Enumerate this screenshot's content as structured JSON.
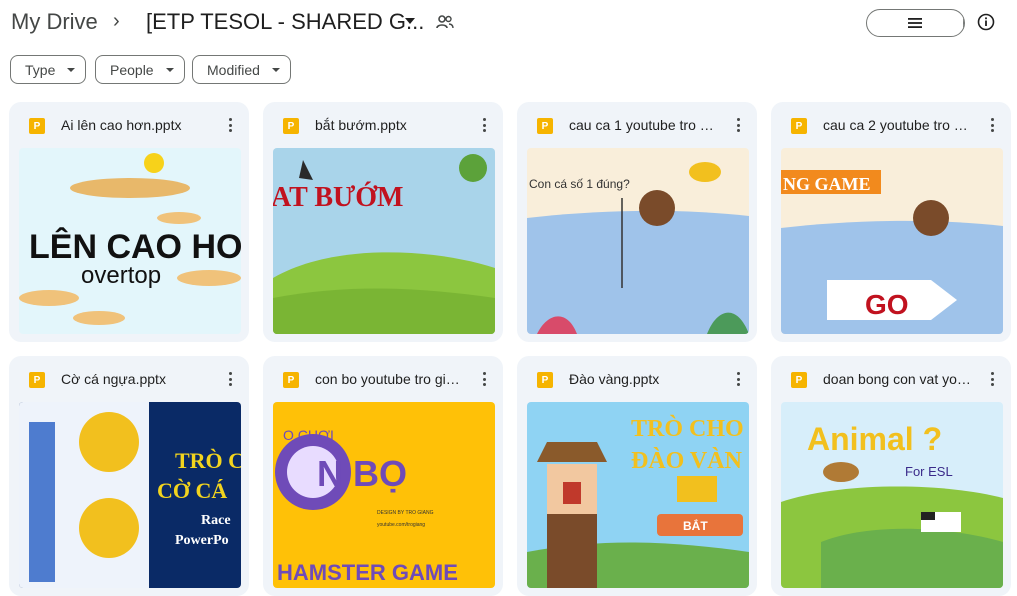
{
  "breadcrumb": {
    "root": "My Drive",
    "separator": "›",
    "current": "[ETP TESOL - SHARED G..."
  },
  "view": {
    "list_icon": "list-icon",
    "grid_icon": "grid-icon",
    "check_icon": "check-icon"
  },
  "filters": [
    {
      "label": "Type"
    },
    {
      "label": "People"
    },
    {
      "label": "Modified"
    }
  ],
  "files": [
    {
      "name": "Ai lên cao hơn.pptx",
      "badge": "P",
      "thumb_text": [
        "LÊN CAO HO",
        "overtop"
      ]
    },
    {
      "name": "bắt bướm.pptx",
      "badge": "P",
      "thumb_text": [
        "AT BƯỚM"
      ]
    },
    {
      "name": "cau ca 1 youtube tro gi...",
      "badge": "P",
      "thumb_text": [
        "Con cá số 1 đúng?"
      ]
    },
    {
      "name": "cau ca 2 youtube tro g...",
      "badge": "P",
      "thumb_text": [
        "NG GAME",
        "GO"
      ]
    },
    {
      "name": "Cờ cá ngựa.pptx",
      "badge": "P",
      "thumb_text": [
        "TRÒ C",
        "CỜ CÁ",
        "Race",
        "PowerPo"
      ]
    },
    {
      "name": "con bo youtube tro gia...",
      "badge": "P",
      "thumb_text": [
        "O CHƠI",
        "N BỌ",
        "DESIGN BY TRO GIANG",
        "youtube.com/trogiang",
        "HAMSTER GAME"
      ]
    },
    {
      "name": "Đào vàng.pptx",
      "badge": "P",
      "thumb_text": [
        "TRÒ CHO",
        "ĐÀO VÀN",
        "BẮT"
      ]
    },
    {
      "name": "doan bong con vat you...",
      "badge": "P",
      "thumb_text": [
        "Animal ?",
        "For ESL"
      ]
    }
  ]
}
